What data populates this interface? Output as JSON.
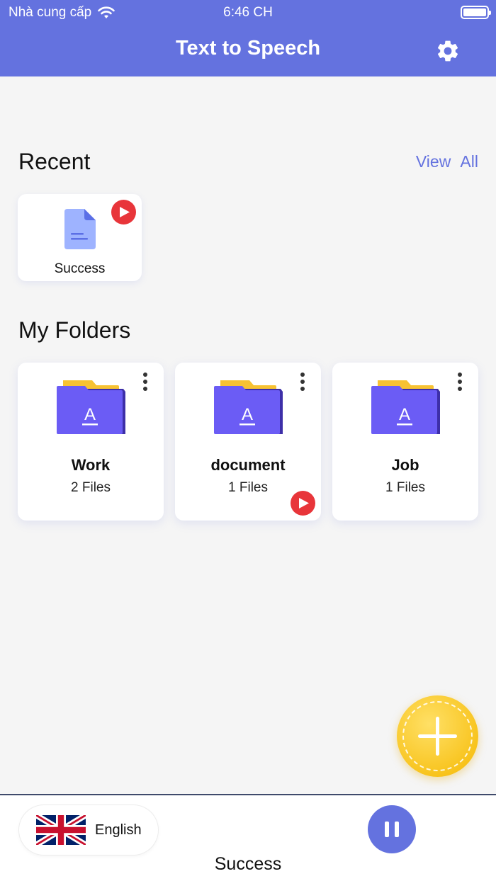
{
  "status_bar": {
    "carrier": "Nhà cung cấp",
    "time": "6:46 CH"
  },
  "header": {
    "title": "Text to Speech",
    "settings_icon": "gear-icon"
  },
  "recent": {
    "title": "Recent",
    "view_all_label": "View All",
    "items": [
      {
        "label": "Success",
        "icon": "document-icon",
        "playing": true
      }
    ]
  },
  "folders": {
    "title": "My Folders",
    "items": [
      {
        "name": "Work",
        "count": "2 Files",
        "icon": "folder-icon",
        "playing": false
      },
      {
        "name": "document",
        "count": "1 Files",
        "icon": "folder-icon",
        "playing": true
      },
      {
        "name": "Job",
        "count": "1 Files",
        "icon": "folder-icon",
        "playing": false
      }
    ]
  },
  "fab": {
    "icon": "plus-icon"
  },
  "player": {
    "language": "English",
    "flag_icon": "uk-flag-icon",
    "now_playing": "Success",
    "control_icon": "pause-icon"
  },
  "colors": {
    "accent": "#6472df",
    "play_badge": "#e8353a",
    "fab": "#f5b800",
    "folder": "#6b5cf5",
    "folder_tab": "#f7c232"
  }
}
